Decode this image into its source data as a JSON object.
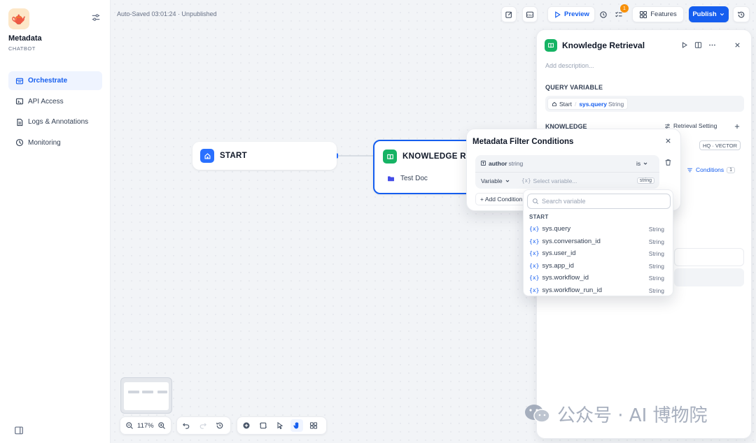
{
  "app": {
    "name": "Metadata",
    "type": "CHATBOT",
    "icon": "teapot-emoji-icon"
  },
  "nav": {
    "items": [
      {
        "label": "Orchestrate",
        "icon": "orchestrate-icon",
        "active": true
      },
      {
        "label": "API Access",
        "icon": "terminal-icon"
      },
      {
        "label": "Logs & Annotations",
        "icon": "document-icon"
      },
      {
        "label": "Monitoring",
        "icon": "monitoring-icon"
      }
    ]
  },
  "header": {
    "status": "Auto-Saved 03:01:24 · Unpublished",
    "preview_label": "Preview",
    "checklist_count": "1",
    "features_label": "Features",
    "publish_label": "Publish"
  },
  "nodes": {
    "start": {
      "title": "START"
    },
    "knowledge": {
      "title": "KNOWLEDGE RETRIEVAL",
      "title_visible": "KNOWLEDGE RET",
      "dataset": "Test Doc"
    }
  },
  "panel": {
    "title": "Knowledge Retrieval",
    "description_placeholder": "Add description...",
    "query_variable_label": "QUERY VARIABLE",
    "query_source": "Start",
    "query_var": "sys.query",
    "query_type": "String",
    "knowledge_label": "KNOWLEDGE",
    "retrieval_setting_label": "Retrieval Setting",
    "hq_vector": "HQ · VECTOR",
    "conditions_label": "Conditions",
    "conditions_count": "1"
  },
  "filter_popup": {
    "title": "Metadata Filter Conditions",
    "field_name": "author",
    "field_type": "string",
    "operator": "is",
    "value_mode": "Variable",
    "value_placeholder": "Select variable...",
    "value_type": "string",
    "add_condition_label": "+ Add Condition"
  },
  "variable_dropdown": {
    "search_placeholder": "Search variable",
    "group_label": "START",
    "variables": [
      {
        "name": "sys.query",
        "type": "String"
      },
      {
        "name": "sys.conversation_id",
        "type": "String"
      },
      {
        "name": "sys.user_id",
        "type": "String"
      },
      {
        "name": "sys.app_id",
        "type": "String"
      },
      {
        "name": "sys.workflow_id",
        "type": "String"
      },
      {
        "name": "sys.workflow_run_id",
        "type": "String"
      }
    ]
  },
  "toolbar": {
    "zoom": "117%"
  },
  "watermark": {
    "text": "公众号 · AI 博物院"
  },
  "colors": {
    "accent": "#155eef",
    "knowledge_green": "#16b364",
    "start_blue": "#2970ff",
    "badge_orange": "#f79009"
  }
}
